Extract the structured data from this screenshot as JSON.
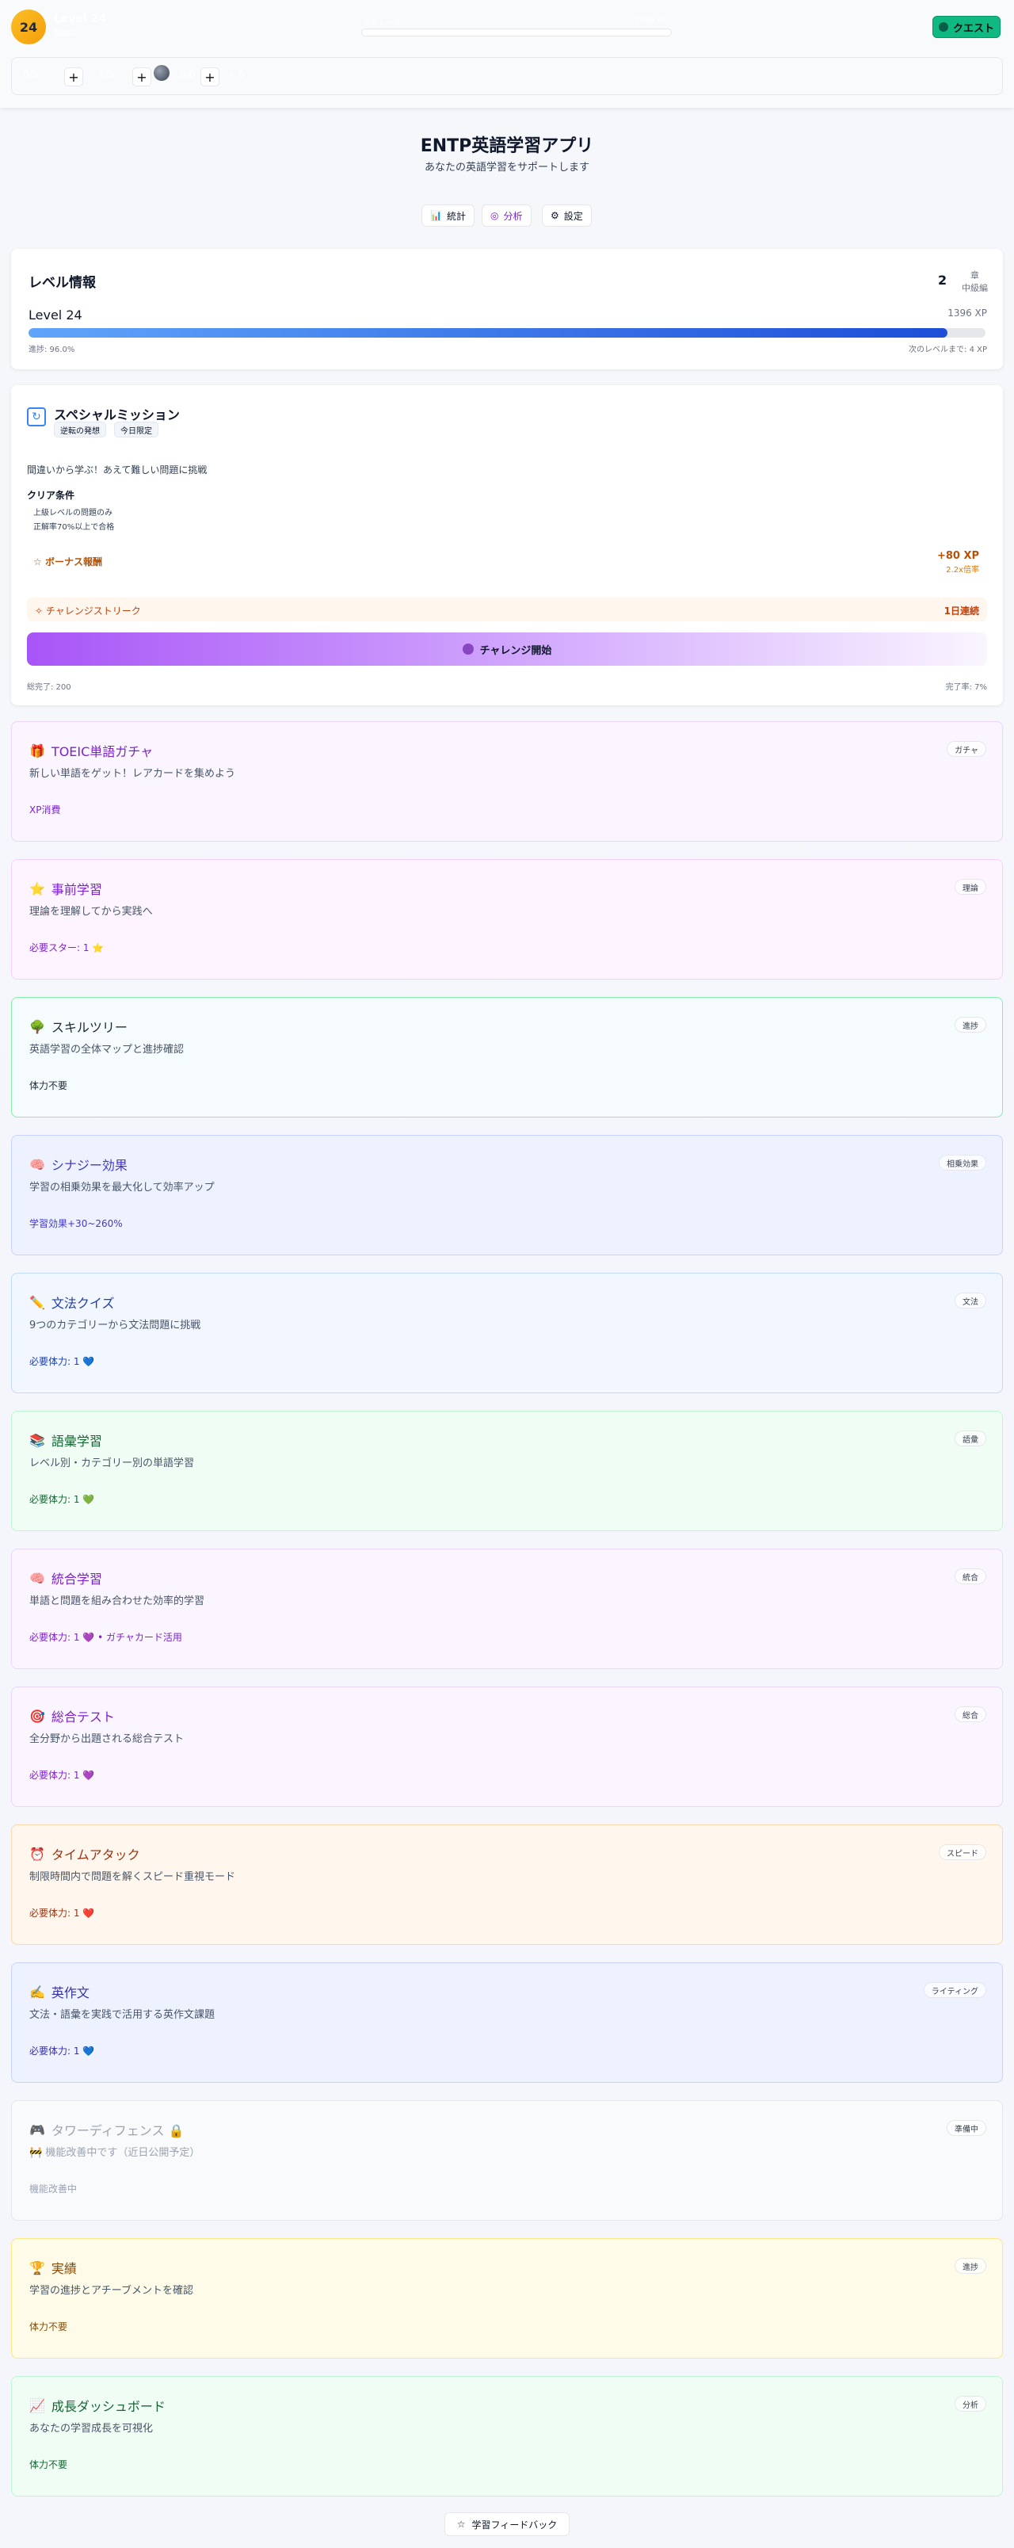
{
  "header": {
    "level_badge": "24",
    "level_label": "Level 24",
    "level_sub": "Basic",
    "xp_label": "次のレベル",
    "xp_right": "1396 XP",
    "quest_label": "クエスト",
    "resources": [
      {
        "label": "0/5"
      },
      {
        "label": "5/5"
      },
      {
        "label": "0/0"
      },
      {
        "label": "+ 0"
      }
    ]
  },
  "app": {
    "title": "ENTP英語学習アプリ",
    "subtitle": "あなたの英語学習をサポートします"
  },
  "nav": {
    "stats": "統計",
    "analysis": "分析",
    "settings": "設定"
  },
  "level_card": {
    "title": "レベル情報",
    "rank_num": "2",
    "rank_top": "章",
    "rank_bottom": "中級編",
    "level": "Level 24",
    "xp": "1396 XP",
    "progress": 0.96,
    "progress_text": "進捗: 96.0%",
    "next_text": "次のレベルまで: 4 XP"
  },
  "mission": {
    "title": "スペシャルミッション",
    "tags": [
      "逆転の発想",
      "今日限定"
    ],
    "desc": "間違いから学ぶ！あえて難しい問題に挑戦",
    "cond_title": "クリア条件",
    "conditions": [
      "上級レベルの問題のみ",
      "正解率70%以上で合格"
    ],
    "bonus_label": "ボーナス報酬",
    "bonus_xp": "+80 XP",
    "bonus_mult": "2.2x倍率",
    "streak_label": "チャレンジストリーク",
    "streak_value": "1日連続",
    "button": "チャレンジ開始",
    "foot_left": "総完了: 200",
    "foot_right": "完了率: 7%"
  },
  "features": [
    {
      "icon": "🎁",
      "title": "TOEIC単語ガチャ",
      "desc": "新しい単語をゲット！レアカードを集めよう",
      "req": "XP消費",
      "tag": "ガチャ",
      "bg": "#faf5ff",
      "border": "#e9d5ff",
      "color": "#7e22ce"
    },
    {
      "icon": "⭐",
      "title": "事前学習",
      "desc": "理論を理解してから実践へ",
      "req": "必要スター: 1 ⭐",
      "tag": "理論",
      "bg": "#fdf4ff",
      "border": "#f5d0fe",
      "color": "#7e22ce"
    },
    {
      "icon": "🌳",
      "title": "スキルツリー",
      "desc": "英語学習の全体マップと進捗確認",
      "req": "体力不要",
      "tag": "進捗",
      "bg": "#f6fbfd",
      "border": "#86efac",
      "color": "#1f2937"
    },
    {
      "icon": "🧠",
      "title": "シナジー効果",
      "desc": "学習の相乗効果を最大化して効率アップ",
      "req": "学習効果+30~260%",
      "tag": "相乗効果",
      "bg": "#eef2ff",
      "border": "#c7d2fe",
      "color": "#4338ca"
    },
    {
      "icon": "✏️",
      "title": "文法クイズ",
      "desc": "9つのカテゴリーから文法問題に挑戦",
      "req": "必要体力: 1 💙",
      "tag": "文法",
      "bg": "#f2f6fe",
      "border": "#bfdbfe",
      "color": "#1e40af"
    },
    {
      "icon": "📚",
      "title": "語彙学習",
      "desc": "レベル別・カテゴリー別の単語学習",
      "req": "必要体力: 1 💚",
      "tag": "語彙",
      "bg": "#f0fdf4",
      "border": "#bbf7d0",
      "color": "#166534"
    },
    {
      "icon": "🧠",
      "title": "統合学習",
      "desc": "単語と問題を組み合わせた効率的学習",
      "req": "必要体力: 1 💜 • ガチャカード活用",
      "tag": "統合",
      "bg": "#fbf5ff",
      "border": "#e9d5ff",
      "color": "#7e22ce"
    },
    {
      "icon": "🎯",
      "title": "総合テスト",
      "desc": "全分野から出題される総合テスト",
      "req": "必要体力: 1 💜",
      "tag": "総合",
      "bg": "#fbf5ff",
      "border": "#e9d5ff",
      "color": "#7e22ce"
    },
    {
      "icon": "⏰",
      "title": "タイムアタック",
      "desc": "制限時間内で問題を解くスピード重視モード",
      "req": "必要体力: 1 ❤️",
      "tag": "スピード",
      "bg": "#fff7ed",
      "border": "#fed7aa",
      "color": "#9a3412"
    },
    {
      "icon": "✍️",
      "title": "英作文",
      "desc": "文法・語彙を実践で活用する英作文課題",
      "req": "必要体力: 1 💙",
      "tag": "ライティング",
      "bg": "#eef2ff",
      "border": "#c7d2fe",
      "color": "#3730a3"
    },
    {
      "icon": "🎮",
      "title": "タワーディフェンス 🔒",
      "desc": "🚧 機能改善中です（近日公開予定）",
      "req": "機能改善中",
      "tag": "準備中",
      "bg": "#f8fafc",
      "border": "#e5e7eb",
      "color": "#9ca3af"
    },
    {
      "icon": "🏆",
      "title": "実績",
      "desc": "学習の進捗とアチーブメントを確認",
      "req": "体力不要",
      "tag": "進捗",
      "bg": "#fefce8",
      "border": "#fde68a",
      "color": "#854d0e"
    },
    {
      "icon": "📈",
      "title": "成長ダッシュボード",
      "desc": "あなたの学習成長を可視化",
      "req": "体力不要",
      "tag": "分析",
      "bg": "#f0fdf4",
      "border": "#bbf7d0",
      "color": "#166534"
    }
  ],
  "footer": {
    "feedback": "学習フィードバック"
  }
}
